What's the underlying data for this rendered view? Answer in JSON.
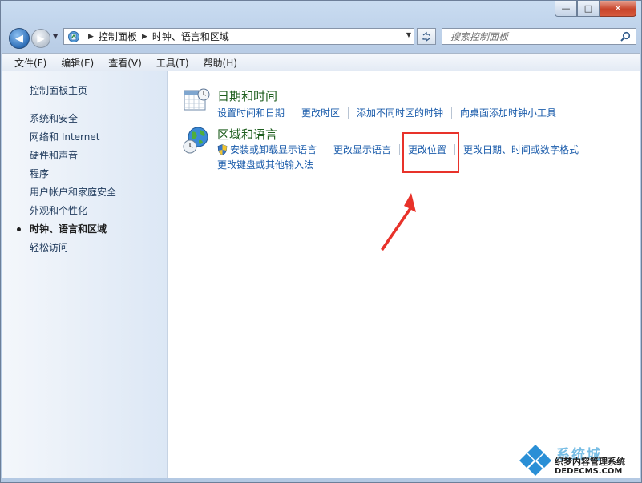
{
  "window": {
    "caption": {
      "minimize": "—",
      "maximize": "□",
      "close": "✕"
    }
  },
  "navbar": {
    "breadcrumb": [
      "控制面板",
      "时钟、语言和区域"
    ],
    "search_placeholder": "搜索控制面板"
  },
  "menubar": {
    "items": [
      "文件(F)",
      "编辑(E)",
      "查看(V)",
      "工具(T)",
      "帮助(H)"
    ]
  },
  "sidebar": {
    "home": "控制面板主页",
    "items": [
      {
        "label": "系统和安全"
      },
      {
        "label": "网络和 Internet"
      },
      {
        "label": "硬件和声音"
      },
      {
        "label": "程序"
      },
      {
        "label": "用户帐户和家庭安全"
      },
      {
        "label": "外观和个性化"
      },
      {
        "label": "时钟、语言和区域",
        "active": true
      },
      {
        "label": "轻松访问"
      }
    ]
  },
  "main": {
    "sections": [
      {
        "title": "日期和时间",
        "icon": "calendar-clock-icon",
        "links": [
          "设置时间和日期",
          "更改时区",
          "添加不同时区的时钟",
          "向桌面添加时钟小工具"
        ]
      },
      {
        "title": "区域和语言",
        "icon": "globe-clock-icon",
        "links": [
          "安装或卸载显示语言",
          "更改显示语言",
          "更改位置",
          "更改日期、时间或数字格式"
        ],
        "links_row2": [
          "更改键盘或其他输入法"
        ]
      }
    ]
  },
  "annotation": {
    "color": "#e8322a"
  },
  "watermark": {
    "line1": "系统城",
    "line2": "织梦内容管理系统",
    "line3": "DEDECMS.COM"
  }
}
